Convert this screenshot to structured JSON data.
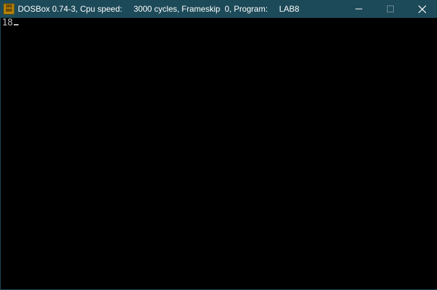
{
  "window": {
    "title": "DOSBox 0.74-3, Cpu speed:     3000 cycles, Frameskip  0, Program:     LAB8",
    "icon": "dosbox-icon",
    "icon_label_top": "DOS",
    "icon_label_bottom": "BOX",
    "controls": {
      "minimize": "—",
      "maximize": "☐",
      "close": "✕"
    }
  },
  "console": {
    "output": "18"
  },
  "colors": {
    "titlebar": "#1d4a59",
    "console_bg": "#000000",
    "console_text": "#c0c0c0"
  }
}
